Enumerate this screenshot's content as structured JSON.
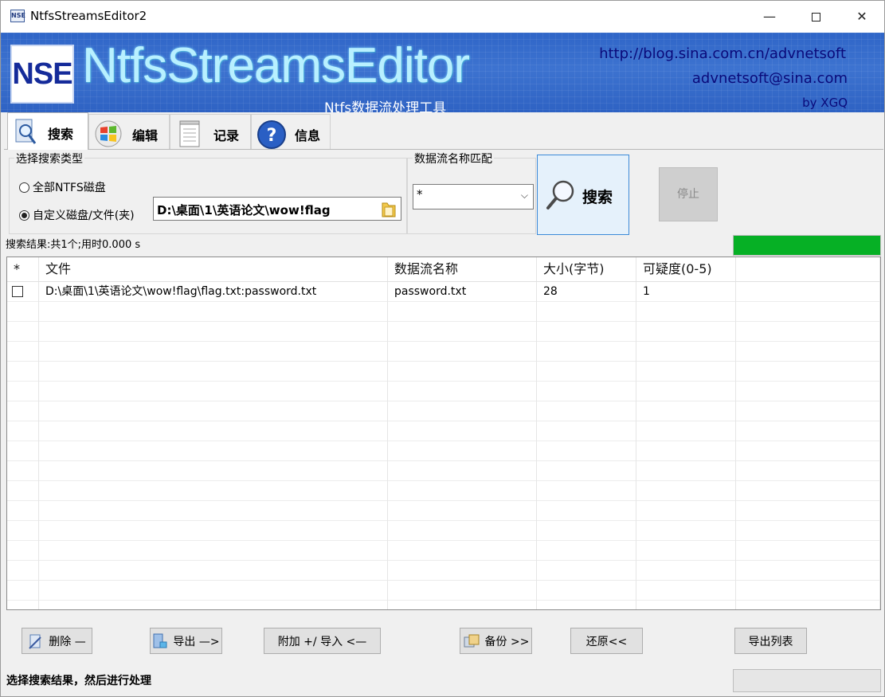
{
  "window": {
    "icon_text": "NSE",
    "title": "NtfsStreamsEditor2",
    "min_glyph": "—",
    "close_glyph": "✕"
  },
  "banner": {
    "logo_text": "NSE",
    "app_name": "NtfsStreamsEditor",
    "subtitle": "Ntfs数据流处理工具",
    "blog_url": "http://blog.sina.com.cn/advnetsoft",
    "email": "advnetsoft@sina.com",
    "by": "by XGQ"
  },
  "tabs": [
    {
      "label": "搜索",
      "icon": "search-doc-icon",
      "active": true
    },
    {
      "label": "编辑",
      "icon": "windows-logo-icon",
      "active": false
    },
    {
      "label": "记录",
      "icon": "notepad-icon",
      "active": false
    },
    {
      "label": "信息",
      "icon": "help-icon",
      "active": false
    }
  ],
  "search_type": {
    "group_title": "选择搜索类型",
    "option_all": "全部NTFS磁盘",
    "option_custom": "自定义磁盘/文件(夹)",
    "selected": "custom",
    "path": "D:\\桌面\\1\\英语论文\\wow!flag"
  },
  "stream_match": {
    "group_title": "数据流名称匹配",
    "value": "*"
  },
  "actions": {
    "search_label": "搜索",
    "stop_label": "停止"
  },
  "result_summary": "搜索结果:共1个;用时0.000 s",
  "progress_fraction": 1.0,
  "table": {
    "columns": [
      "*",
      "文件",
      "数据流名称",
      "大小(字节)",
      "可疑度(0-5)"
    ],
    "rows": [
      {
        "checked": false,
        "file": "D:\\桌面\\1\\英语论文\\wow!flag\\flag.txt:password.txt",
        "stream": "password.txt",
        "size": "28",
        "suspicion": "1"
      }
    ]
  },
  "buttons": {
    "delete": "删除 —",
    "export": "导出 —>",
    "attach_import": "附加 +/ 导入 <—",
    "backup": "备份 >>",
    "restore": "还原<<",
    "export_list": "导出列表"
  },
  "status_text": "选择搜索结果，然后进行处理",
  "colors": {
    "banner": "#3069c9",
    "progress": "#06b025",
    "link": "#0a0a7a"
  }
}
